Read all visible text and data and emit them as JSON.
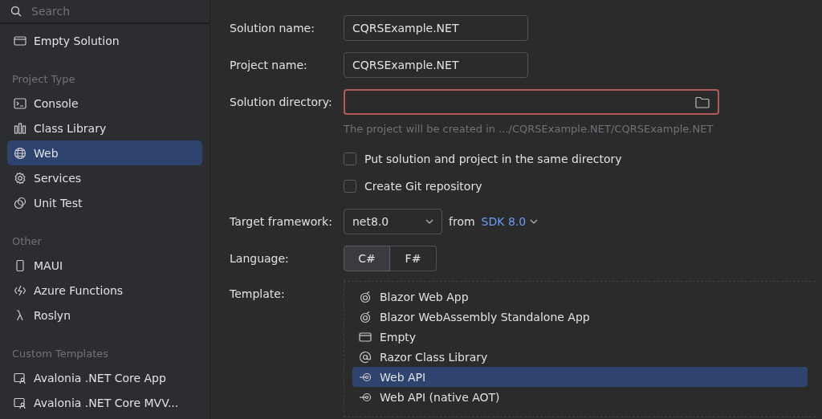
{
  "sidebar": {
    "search": {
      "placeholder": "Search"
    },
    "top_items": [
      {
        "label": "Empty Solution",
        "selected": false
      }
    ],
    "groups": [
      {
        "title": "Project Type",
        "items": [
          {
            "label": "Console",
            "selected": false
          },
          {
            "label": "Class Library",
            "selected": false
          },
          {
            "label": "Web",
            "selected": true
          },
          {
            "label": "Services",
            "selected": false
          },
          {
            "label": "Unit Test",
            "selected": false
          }
        ]
      },
      {
        "title": "Other",
        "items": [
          {
            "label": "MAUI",
            "selected": false
          },
          {
            "label": "Azure Functions",
            "selected": false
          },
          {
            "label": "Roslyn",
            "selected": false
          }
        ]
      },
      {
        "title": "Custom Templates",
        "items": [
          {
            "label": "Avalonia .NET Core App",
            "selected": false
          },
          {
            "label": "Avalonia .NET Core MVV...",
            "selected": false
          }
        ]
      }
    ]
  },
  "form": {
    "solution_name": {
      "label": "Solution name:",
      "value": "CQRSExample.NET"
    },
    "project_name": {
      "label": "Project name:",
      "value": "CQRSExample.NET"
    },
    "solution_directory": {
      "label": "Solution directory:",
      "error": true,
      "hint": "The project will be created in .../CQRSExample.NET/CQRSExample.NET"
    },
    "checkboxes": [
      {
        "label": "Put solution and project in the same directory",
        "checked": false
      },
      {
        "label": "Create Git repository",
        "checked": false
      }
    ],
    "target_framework": {
      "label": "Target framework:",
      "value": "net8.0",
      "from": "from",
      "sdk": "SDK 8.0"
    },
    "language": {
      "label": "Language:",
      "options": [
        {
          "label": "C#",
          "selected": true
        },
        {
          "label": "F#",
          "selected": false
        }
      ]
    },
    "template": {
      "label": "Template:",
      "items": [
        {
          "label": "Blazor Web App",
          "selected": false
        },
        {
          "label": "Blazor WebAssembly Standalone App",
          "selected": false
        },
        {
          "label": "Empty",
          "selected": false
        },
        {
          "label": "Razor Class Library",
          "selected": false
        },
        {
          "label": "Web API",
          "selected": true
        },
        {
          "label": "Web API (native AOT)",
          "selected": false
        }
      ]
    }
  }
}
